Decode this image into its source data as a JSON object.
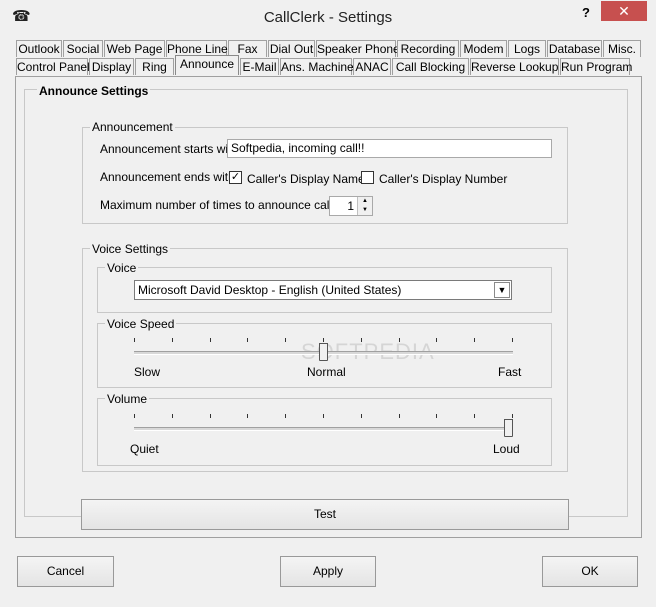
{
  "window": {
    "title": "CallClerk - Settings",
    "help": "?",
    "close": "✕"
  },
  "tabs_row1": [
    "Outlook",
    "Social",
    "Web Page",
    "Phone Line",
    "Fax",
    "Dial Out",
    "Speaker Phone",
    "Recording",
    "Modem",
    "Logs",
    "Database",
    "Misc."
  ],
  "tabs_row2": [
    "Control Panel",
    "Display",
    "Ring",
    "Announce",
    "E-Mail",
    "Ans. Machine",
    "ANAC",
    "Call Blocking",
    "Reverse Lookup",
    "Run Program"
  ],
  "active_tab": "Announce",
  "section_title": "Announce Settings",
  "announcement": {
    "group_label": "Announcement",
    "starts_label": "Announcement starts with:",
    "starts_value": "Softpedia, incoming call!!",
    "ends_label": "Announcement ends with:",
    "opt_name_label": "Caller's Display Name",
    "opt_name_checked": true,
    "opt_number_label": "Caller's Display Number",
    "opt_number_checked": false,
    "max_label": "Maximum number of times to announce caller:",
    "max_value": "1"
  },
  "voice_settings": {
    "group_label": "Voice Settings",
    "voice_label": "Voice",
    "voice_value": "Microsoft David Desktop - English (United States)",
    "speed_label": "Voice Speed",
    "speed_min": "Slow",
    "speed_mid": "Normal",
    "speed_max": "Fast",
    "speed_level": 0.5,
    "volume_label": "Volume",
    "volume_min": "Quiet",
    "volume_max": "Loud",
    "volume_level": 1.0
  },
  "test_label": "Test",
  "footer": {
    "cancel": "Cancel",
    "apply": "Apply",
    "ok": "OK"
  },
  "watermark": "SOFTPEDIA"
}
